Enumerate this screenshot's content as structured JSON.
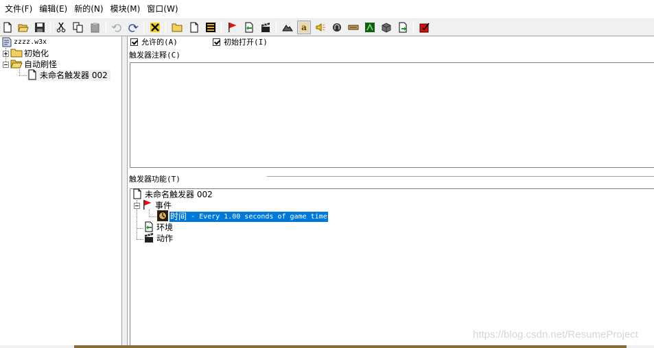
{
  "menu": [
    "文件(F)",
    "编辑(E)",
    "新的(N)",
    "模块(M)",
    "窗口(W)"
  ],
  "toolbar_buttons": [
    "new-icon",
    "open-icon",
    "save-icon",
    "cut-icon",
    "copy-icon",
    "paste-icon",
    "undo-icon",
    "redo-icon",
    "delete-icon",
    "new-category-icon",
    "new-trigger-icon",
    "new-comment-icon",
    "event-flag-icon",
    "condition-icon",
    "action-icon",
    "terrain-editor-icon",
    "trigger-editor-icon",
    "sound-editor-icon",
    "object-editor-icon",
    "campaign-editor-icon",
    "ai-editor-icon",
    "object-manager-icon",
    "import-manager-icon",
    "test-map-icon"
  ],
  "tree": {
    "root": "zzzz.w3x",
    "categories": [
      {
        "label": "初始化",
        "expanded": false
      },
      {
        "label": "自动刷怪",
        "expanded": true,
        "children": [
          "未命名触发器 002"
        ]
      }
    ]
  },
  "editor": {
    "enabled_label": "允许的(A)",
    "enabled_checked": true,
    "initially_on_label": "初始打开(I)",
    "initially_on_checked": true,
    "comment_label": "触发器注释(C)",
    "comment_value": "",
    "functions_label": "触发器功能(T)",
    "functions": {
      "trigger_name": "未命名触发器 002",
      "events_label": "事件",
      "event_item_prefix": "时间",
      "event_item_text": " - Every 1.00 seconds of game time",
      "conditions_label": "环境",
      "actions_label": "动作"
    }
  },
  "watermark": "https://blog.csdn.net/ResumeProject",
  "colors": {
    "selection": "#0078d7",
    "toolbar_bg": "#f0f0f0"
  }
}
